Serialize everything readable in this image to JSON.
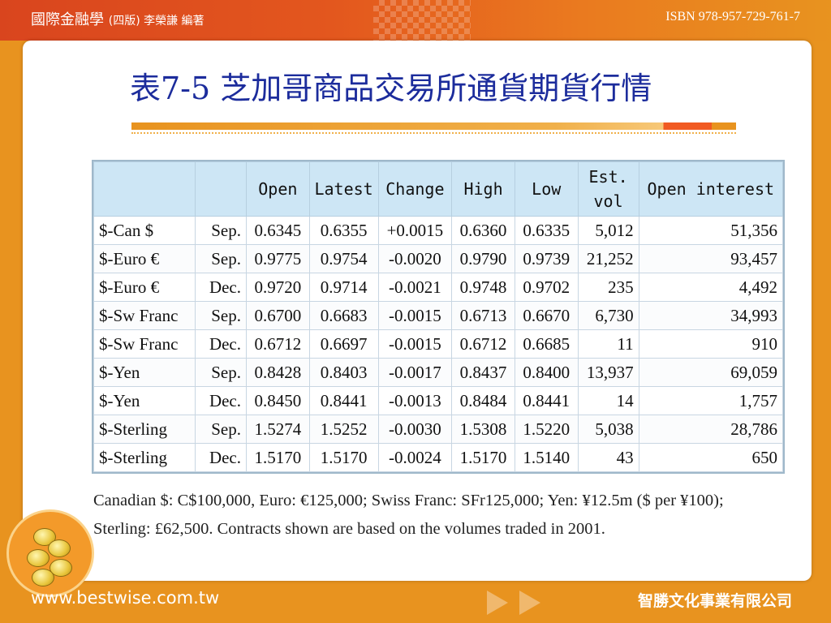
{
  "header": {
    "book_title": "國際金融學",
    "edition": "(四版) 李榮謙 編著",
    "isbn": "ISBN 978-957-729-761-7"
  },
  "slide": {
    "title": "表7-5 芝加哥商品交易所通貨期貨行情"
  },
  "table": {
    "columns": [
      "",
      "",
      "Open",
      "Latest",
      "Change",
      "High",
      "Low",
      "Est. vol",
      "Open interest"
    ],
    "rows": [
      {
        "symbol": "$-Can $",
        "month": "Sep.",
        "open": "0.6345",
        "latest": "0.6355",
        "change": "+0.0015",
        "high": "0.6360",
        "low": "0.6335",
        "vol": "5,012",
        "oi": "51,356"
      },
      {
        "symbol": "$-Euro €",
        "month": "Sep.",
        "open": "0.9775",
        "latest": "0.9754",
        "change": "-0.0020",
        "high": "0.9790",
        "low": "0.9739",
        "vol": "21,252",
        "oi": "93,457"
      },
      {
        "symbol": "$-Euro €",
        "month": "Dec.",
        "open": "0.9720",
        "latest": "0.9714",
        "change": "-0.0021",
        "high": "0.9748",
        "low": "0.9702",
        "vol": "235",
        "oi": "4,492"
      },
      {
        "symbol": "$-Sw Franc",
        "month": "Sep.",
        "open": "0.6700",
        "latest": "0.6683",
        "change": "-0.0015",
        "high": "0.6713",
        "low": "0.6670",
        "vol": "6,730",
        "oi": "34,993"
      },
      {
        "symbol": "$-Sw Franc",
        "month": "Dec.",
        "open": "0.6712",
        "latest": "0.6697",
        "change": "-0.0015",
        "high": "0.6712",
        "low": "0.6685",
        "vol": "11",
        "oi": "910"
      },
      {
        "symbol": "$-Yen",
        "month": "Sep.",
        "open": "0.8428",
        "latest": "0.8403",
        "change": "-0.0017",
        "high": "0.8437",
        "low": "0.8400",
        "vol": "13,937",
        "oi": "69,059"
      },
      {
        "symbol": "$-Yen",
        "month": "Dec.",
        "open": "0.8450",
        "latest": "0.8441",
        "change": "-0.0013",
        "high": "0.8484",
        "low": "0.8441",
        "vol": "14",
        "oi": "1,757"
      },
      {
        "symbol": "$-Sterling",
        "month": "Sep.",
        "open": "1.5274",
        "latest": "1.5252",
        "change": "-0.0030",
        "high": "1.5308",
        "low": "1.5220",
        "vol": "5,038",
        "oi": "28,786"
      },
      {
        "symbol": "$-Sterling",
        "month": "Dec.",
        "open": "1.5170",
        "latest": "1.5170",
        "change": "-0.0024",
        "high": "1.5170",
        "low": "1.5140",
        "vol": "43",
        "oi": "650"
      }
    ]
  },
  "note": {
    "line1": "Canadian $: C$100,000, Euro: €125,000; Swiss Franc: SFr125,000; Yen: ¥12.5m ($ per ¥100);",
    "line2": "Sterling: £62,500. Contracts shown are based on the volumes traded in 2001."
  },
  "footer": {
    "url": "www.bestwise.com.tw",
    "company": "智勝文化事業有限公司"
  },
  "icons": {
    "coins": "coin-stack-icon"
  },
  "colors": {
    "title": "#1c2c9c",
    "header_fill": "#cde6f5",
    "frame": "#e8931f"
  }
}
